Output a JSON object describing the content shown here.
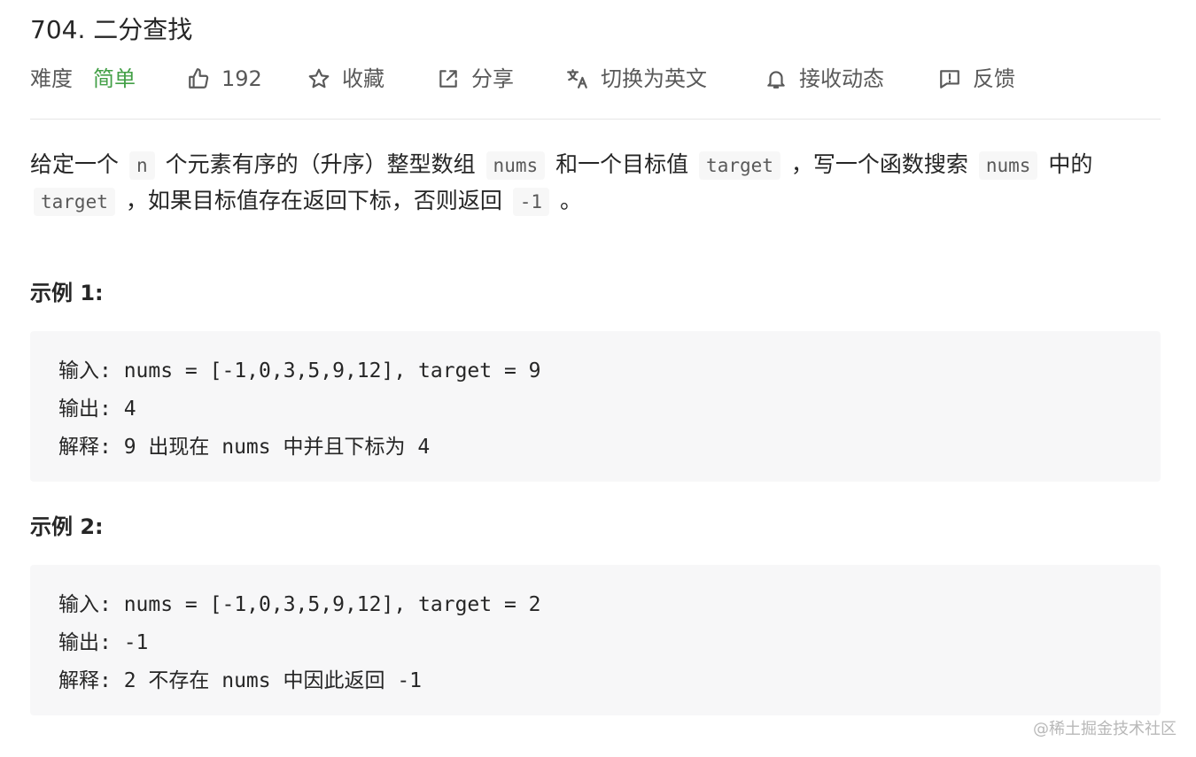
{
  "problem": {
    "title": "704. 二分查找"
  },
  "toolbar": {
    "difficulty_label": "难度",
    "difficulty_value": "简单",
    "difficulty_color": "#43a047",
    "like_count": "192",
    "like_icon": "thumbs-up-icon",
    "favorite_label": "收藏",
    "favorite_icon": "star-icon",
    "share_label": "分享",
    "share_icon": "share-icon",
    "translate_label": "切换为英文",
    "translate_icon": "translate-icon",
    "subscribe_label": "接收动态",
    "subscribe_icon": "bell-icon",
    "feedback_label": "反馈",
    "feedback_icon": "feedback-icon"
  },
  "description": {
    "p1": "给定一个",
    "code_n": "n",
    "p2": "个元素有序的（升序）整型数组",
    "code_nums1": "nums",
    "p3": "和一个目标值",
    "code_target1": "target",
    "p4": "，写一个函数搜索",
    "code_nums2": "nums",
    "p5": "中的",
    "code_target2": "target",
    "p6": "，如果目标值存在返回下标，否则返回",
    "code_neg1": "-1",
    "p7": "。"
  },
  "examples": [
    {
      "title": "示例 1:",
      "input": "输入: nums = [-1,0,3,5,9,12], target = 9",
      "output": "输出: 4",
      "explanation": "解释: 9 出现在 nums 中并且下标为 4"
    },
    {
      "title": "示例 2:",
      "input": "输入: nums = [-1,0,3,5,9,12], target = 2",
      "output": "输出: -1",
      "explanation": "解释: 2 不存在 nums 中因此返回 -1"
    }
  ],
  "watermark": "@稀土掘金技术社区"
}
